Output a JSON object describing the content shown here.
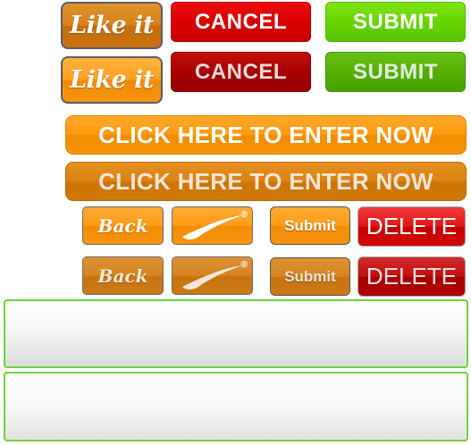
{
  "row1": {
    "like_label": "Like it",
    "cancel_label": "CANCEL",
    "submit_label": "SUBMIT"
  },
  "row2": {
    "like_label": "Like it",
    "cancel_label": "CANCEL",
    "submit_label": "SUBMIT"
  },
  "click_row1": {
    "label": "CLICK HERE TO ENTER NOW"
  },
  "click_row2": {
    "label": "CLICK HERE TO ENTER NOW"
  },
  "small_row1": {
    "back_label": "Back",
    "swoosh_reg": "®",
    "submit_label": "Submit",
    "delete_label": "DELETE"
  },
  "small_row2": {
    "back_label": "Back",
    "swoosh_reg": "®",
    "submit_label": "Submit",
    "delete_label": "DELETE"
  },
  "icons": {
    "swoosh": "swoosh-logo-icon"
  },
  "colors": {
    "orange": "#ff9b16",
    "red": "#d80000",
    "green": "#66d400",
    "panel_border": "#6cd43a"
  }
}
